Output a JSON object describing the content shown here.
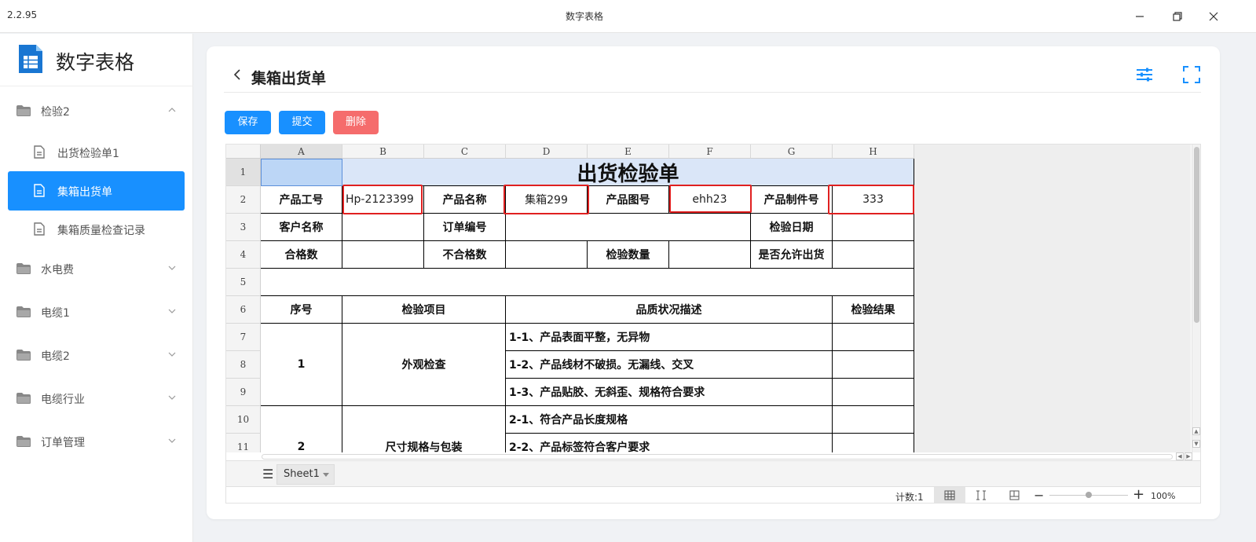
{
  "window": {
    "version": "2.2.95",
    "title": "数字表格"
  },
  "brand": {
    "name": "数字表格"
  },
  "sidebar": {
    "group_open": "检验2",
    "sub_items": [
      "出货检验单1",
      "集箱出货单",
      "集箱质量检查记录"
    ],
    "active_sub": "集箱出货单",
    "groups": [
      "水电费",
      "电缆1",
      "电缆2",
      "电缆行业",
      "订单管理"
    ]
  },
  "page": {
    "title": "集箱出货单"
  },
  "buttons": {
    "save": "保存",
    "submit": "提交",
    "delete": "删除"
  },
  "colors": {
    "primary": "#1890ff",
    "danger": "#f56c6c",
    "title_fill": "#dae6f8",
    "selection": "#bcd6f6",
    "highlight": "#e02020"
  },
  "sheet": {
    "columns": [
      "A",
      "B",
      "C",
      "D",
      "E",
      "F",
      "G",
      "H"
    ],
    "rows": [
      "1",
      "2",
      "3",
      "4",
      "5",
      "6",
      "7",
      "8",
      "9",
      "10",
      "11"
    ],
    "title": "出货检验单",
    "row2": {
      "a": "产品工号",
      "b": "Hp-2123399",
      "c": "产品名称",
      "d": "集箱299",
      "e": "产品图号",
      "f": "ehh23",
      "g": "产品制件号",
      "h": "333"
    },
    "row3": {
      "a": "客户名称",
      "c": "订单编号",
      "g": "检验日期"
    },
    "row4": {
      "a": "合格数",
      "c": "不合格数",
      "e": "检验数量",
      "g": "是否允许出货"
    },
    "row6": {
      "a": "序号",
      "b": "检验项目",
      "d": "品质状况描述",
      "h": "检验结果"
    },
    "group1": {
      "no": "1",
      "item": "外观检查",
      "desc": [
        "1-1、产品表面平整，无异物",
        "1-2、产品线材不破损。无漏线、交叉",
        "1-3、产品贴胶、无斜歪、规格符合要求"
      ]
    },
    "group2": {
      "no": "2",
      "item": "尺寸规格与包装",
      "desc": [
        "2-1、符合产品长度规格",
        "2-2、产品标签符合客户要求"
      ]
    },
    "sheet_tab": "Sheet1"
  },
  "status": {
    "count": "计数:1",
    "zoom": "100%"
  }
}
